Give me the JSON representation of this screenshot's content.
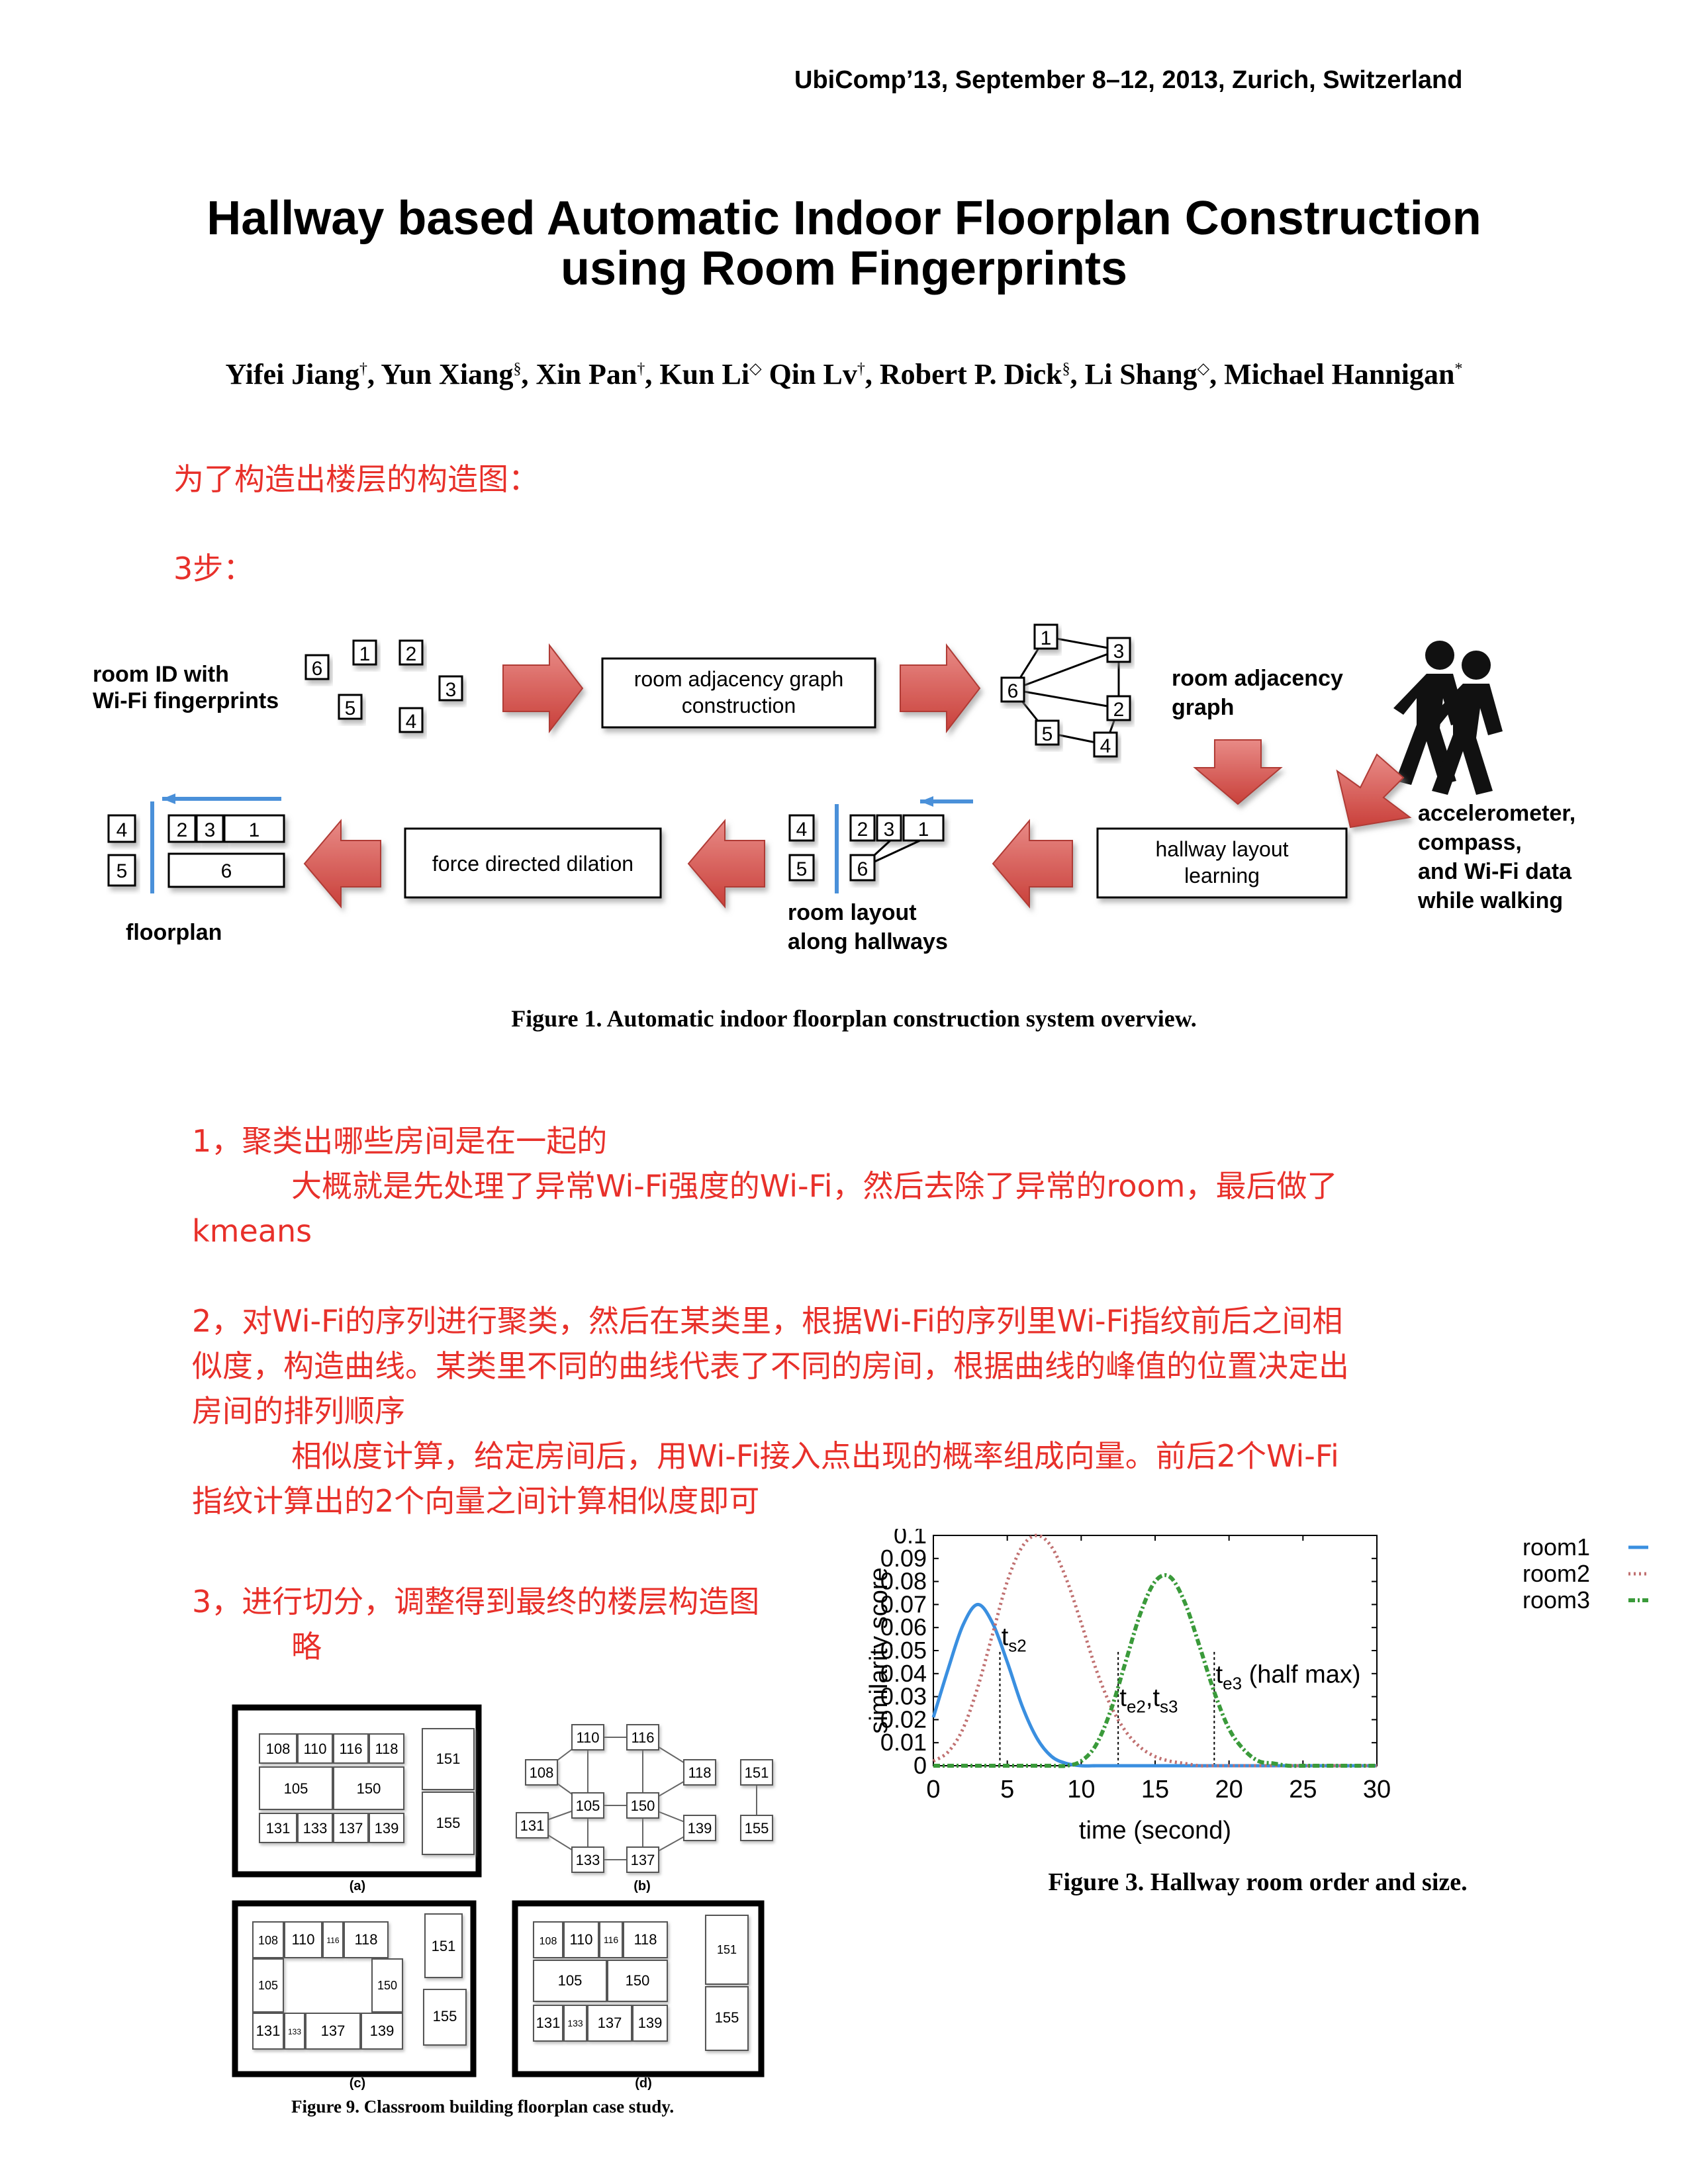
{
  "header": {
    "conference": "UbiComp’13, September 8–12, 2013, Zurich, Switzerland"
  },
  "paper": {
    "title_line1": "Hallway based Automatic Indoor Floorplan Construction",
    "title_line2": "using Room Fingerprints",
    "authors": [
      {
        "name": "Yifei Jiang",
        "mark": "†",
        "sep": ", "
      },
      {
        "name": "Yun Xiang",
        "mark": "§",
        "sep": ", "
      },
      {
        "name": "Xin Pan",
        "mark": "†",
        "sep": ", "
      },
      {
        "name": "Kun Li",
        "mark": "◇",
        "sep": " "
      },
      {
        "name": "Qin Lv",
        "mark": "†",
        "sep": ", "
      },
      {
        "name": "Robert P. Dick",
        "mark": "§",
        "sep": ", "
      },
      {
        "name": "Li Shang",
        "mark": "◇",
        "sep": ", "
      },
      {
        "name": "Michael Hannigan",
        "mark": "*",
        "sep": ""
      }
    ]
  },
  "notes": {
    "intro": "为了构造出楼层的构造图：",
    "steps": "3步：",
    "s1_title": "1，聚类出哪些房间是在一起的",
    "s1_detail_a": "大概就是先处理了异常Wi-Fi强度的Wi-Fi，然后去除了异常的room，最后做了",
    "s1_detail_b": "kmeans",
    "s2_line1": "2，对Wi-Fi的序列进行聚类，然后在某类里，根据Wi-Fi的序列里Wi-Fi指纹前后之间相",
    "s2_line2": "似度，构造曲线。某类里不同的曲线代表了不同的房间，根据曲线的峰值的位置决定出",
    "s2_line3": "房间的排列顺序",
    "s2_detail_a": "相似度计算，给定房间后，用Wi-Fi接入点出现的概率组成向量。前后2个Wi-Fi",
    "s2_detail_b": "指纹计算出的2个向量之间计算相似度即可",
    "s3_title": "3，进行切分，调整得到最终的楼层构造图",
    "s3_detail": "略"
  },
  "figure1": {
    "caption": "Figure 1. Automatic indoor floorplan construction system overview.",
    "label_room_id_1": "room ID with",
    "label_room_id_2": "Wi-Fi fingerprints",
    "box_adjacency_1": "room adjacency graph",
    "box_adjacency_2": "construction",
    "label_graph_1": "room adjacency",
    "label_graph_2": "graph",
    "box_hallway_1": "hallway layout",
    "box_hallway_2": "learning",
    "box_force": "force directed dilation",
    "label_sensor_1": "accelerometer,",
    "label_sensor_2": "compass,",
    "label_sensor_3": "and Wi-Fi data",
    "label_sensor_4": "while walking",
    "label_layout_1": "room layout",
    "label_layout_2": "along hallways",
    "label_floorplan": "floorplan",
    "rooms": {
      "r1": "1",
      "r2": "2",
      "r3": "3",
      "r4": "4",
      "r5": "5",
      "r6": "6"
    }
  },
  "figure9": {
    "caption": "Figure 9. Classroom building floorplan case study.",
    "panel_a": "(a)",
    "panel_b": "(b)",
    "panel_c": "(c)",
    "panel_d": "(d)",
    "rooms": {
      "r108": "108",
      "r110": "110",
      "r116": "116",
      "r118": "118",
      "r105": "105",
      "r150": "150",
      "r131": "131",
      "r133": "133",
      "r137": "137",
      "r139": "139",
      "r151": "151",
      "r155": "155"
    }
  },
  "figure3": {
    "caption": "Figure 3. Hallway room order and size.",
    "ann_ts2": "t",
    "ann_ts2_sub": "s2",
    "ann_te2": "t",
    "ann_te2_sub": "e2",
    "ann_sep": ",",
    "ann_ts3": "t",
    "ann_ts3_sub": "s3",
    "ann_te3": "t",
    "ann_te3_sub": "e3",
    "ann_halfmax": " (half max)"
  },
  "colors": {
    "note_red": "#e8302a",
    "arrow_red": "#d9534f",
    "room1": "#3a8fe0",
    "room2": "#c07070",
    "room3": "#3a9a3a"
  },
  "chart_data": {
    "type": "line",
    "xlabel": "time (second)",
    "ylabel": "similarity score",
    "xlim": [
      0,
      30
    ],
    "ylim": [
      0,
      0.1
    ],
    "xticks": [
      "0",
      "5",
      "10",
      "15",
      "20",
      "25",
      "30"
    ],
    "yticks": [
      "0",
      "0.01",
      "0.02",
      "0.03",
      "0.04",
      "0.05",
      "0.06",
      "0.07",
      "0.08",
      "0.09",
      "0.1"
    ],
    "legend_position": "right-outside-top",
    "grid": false,
    "x": [
      0,
      1,
      2,
      3,
      4,
      5,
      6,
      7,
      8,
      9,
      10,
      11,
      12,
      13,
      14,
      15,
      16,
      17,
      18,
      19,
      20,
      21,
      22,
      23,
      24,
      25,
      26,
      27,
      28,
      29,
      30
    ],
    "series": [
      {
        "name": "room1",
        "style": "solid",
        "values": [
          0.021,
          0.042,
          0.061,
          0.07,
          0.062,
          0.045,
          0.026,
          0.012,
          0.004,
          0.001,
          0,
          0,
          0,
          0,
          0,
          0,
          0,
          0,
          0,
          0,
          0,
          0,
          0,
          0,
          0,
          0,
          0,
          0,
          0,
          0,
          0
        ]
      },
      {
        "name": "room2",
        "style": "dotted",
        "values": [
          0.002,
          0.006,
          0.016,
          0.034,
          0.057,
          0.08,
          0.095,
          0.1,
          0.095,
          0.081,
          0.062,
          0.042,
          0.026,
          0.015,
          0.008,
          0.004,
          0.002,
          0.001,
          0,
          0,
          0,
          0,
          0,
          0,
          0,
          0,
          0,
          0,
          0,
          0,
          0
        ]
      },
      {
        "name": "room3",
        "style": "dashdot",
        "values": [
          0,
          0,
          0,
          0,
          0,
          0,
          0,
          0,
          0,
          0,
          0.002,
          0.009,
          0.024,
          0.045,
          0.066,
          0.08,
          0.082,
          0.071,
          0.052,
          0.032,
          0.016,
          0.007,
          0.002,
          0.001,
          0,
          0,
          0,
          0,
          0,
          0,
          0
        ]
      }
    ],
    "vlines": [
      4.5,
      12.5,
      19
    ]
  }
}
